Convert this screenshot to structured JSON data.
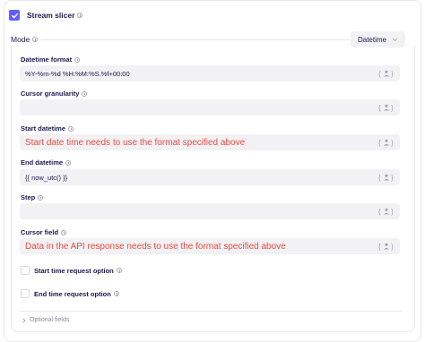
{
  "stream_slicer": {
    "label": "Stream slicer",
    "checked": true
  },
  "mode": {
    "label": "Mode",
    "selected": "Datetime"
  },
  "fields": [
    {
      "label": "Datetime format",
      "value": "%Y-%m-%d %H:%M:%S.%f+00:00"
    },
    {
      "label": "Cursor granularity",
      "value": ""
    },
    {
      "label": "Start datetime",
      "value": "Start date time needs to use the format specified above"
    },
    {
      "label": "End datetime",
      "value": "{{ now_utc() }}"
    },
    {
      "label": "Step",
      "value": ""
    },
    {
      "label": "Cursor field",
      "value": "Data in the API response needs to use the format specified above"
    }
  ],
  "options": [
    {
      "label": "Start time request option",
      "checked": false
    },
    {
      "label": "End time request option",
      "checked": false
    }
  ],
  "optional_fields": {
    "label": "Optional fields"
  },
  "colors": {
    "accent": "#615eff",
    "hint_text": "#e84a3f",
    "input_bg": "#f2f2f5",
    "text": "#1a194d"
  },
  "icons": {
    "checkbox": "check-icon",
    "info": "info-icon",
    "user": "user-reference-icon",
    "chevron": "chevron-down-icon",
    "expand": "chevron-right-icon"
  }
}
